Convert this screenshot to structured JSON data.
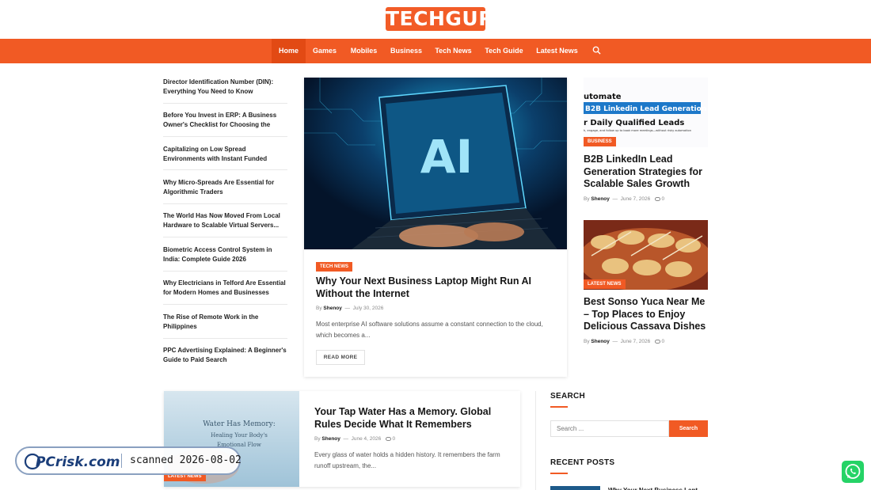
{
  "header": {
    "logo_text": "TECHGUP"
  },
  "nav": {
    "items": [
      "Home",
      "Games",
      "Mobiles",
      "Business",
      "Tech News",
      "Tech Guide",
      "Latest News"
    ],
    "active": "Home",
    "search_icon": "search-icon"
  },
  "sidebar_links": [
    "Director Identification Number (DIN): Everything You Need to Know",
    "Before You Invest in ERP: A Business Owner's Checklist for Choosing the Rig...",
    "Capitalizing on Low Spread Environments with Instant Funded Accounts",
    "Why Micro-Spreads Are Essential for Algorithmic Traders",
    "The World Has Now Moved From Local Hardware to Scalable Virtual Servers...",
    "Biometric Access Control System in India: Complete Guide 2026",
    "Why Electricians in Telford Are Essential for Modern Homes and Businesses",
    "The Rise of Remote Work in the Philippines",
    "PPC Advertising Explained: A Beginner's Guide to Paid Search"
  ],
  "feature": {
    "image_text": "AI",
    "category": "TECH NEWS",
    "title": "Why Your Next Business Laptop Might Run AI Without the Internet",
    "by": "By",
    "author": "Shenoy",
    "sep": "—",
    "date": "July 30, 2026",
    "excerpt": "Most enterprise AI software solutions assume a constant connection to the cloud, which becomes a...",
    "read_more": "READ MORE"
  },
  "right_posts": [
    {
      "image_lines": [
        "utomate",
        "B2B Linkedin Lead Generation",
        "r Daily Qualified Leads",
        "h, engage, and follow up to book more meetings—without risky automation"
      ],
      "category": "BUSINESS",
      "title": "B2B LinkedIn Lead Generation Strategies for Scalable Sales Growth",
      "by": "By",
      "author": "Shenoy",
      "sep": "—",
      "date": "June 7, 2026",
      "comments": "0"
    },
    {
      "image_lines": [],
      "category": "LATEST NEWS",
      "title": "Best Sonso Yuca Near Me – Top Places to Enjoy Delicious Cassava Dishes",
      "by": "By",
      "author": "Shenoy",
      "sep": "—",
      "date": "June 7, 2026",
      "comments": "0"
    }
  ],
  "wide_post": {
    "image_lines": [
      "Water Has Memory:",
      "Healing Your Body's",
      "Emotional Flow"
    ],
    "category": "LATEST NEWS",
    "title": "Your Tap Water Has a Memory. Global Rules Decide What It Remembers",
    "by": "By",
    "author": "Shenoy",
    "sep": "—",
    "date": "June 4, 2026",
    "comments": "0",
    "excerpt": "Every glass of water holds a hidden history. It remembers the farm runoff upstream, the..."
  },
  "search_widget": {
    "title": "SEARCH",
    "placeholder": "Search ...",
    "button": "Search"
  },
  "recent_posts": {
    "title": "RECENT POSTS",
    "first_item_partial": "Why Your Next Business Lapt"
  },
  "watermark": {
    "logo": "PCrisk.com",
    "scanned": "scanned 2026-08-02"
  },
  "colors": {
    "accent": "#f15a24",
    "nav_active": "#e24a14",
    "whatsapp": "#25d366"
  }
}
